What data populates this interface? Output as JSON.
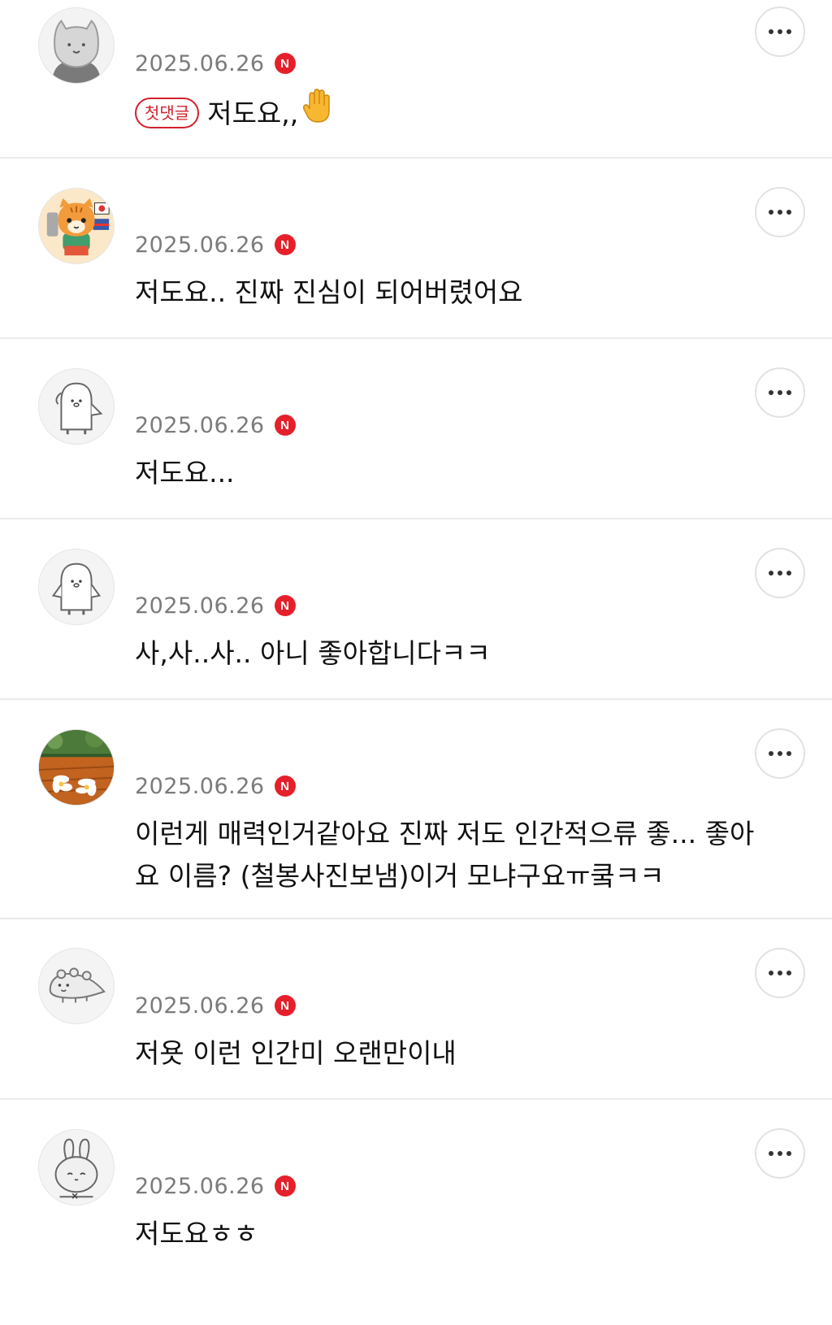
{
  "comments": [
    {
      "date": "2025.06.26",
      "badge": "N",
      "tag": "첫댓글",
      "text": "저도요,,",
      "avatar": "gray-cat-avatar"
    },
    {
      "date": "2025.06.26",
      "badge": "N",
      "tag": "",
      "text": "저도요.. 진짜 진심이 되어버렸어요",
      "avatar": "tiger-cat-with-flags-avatar"
    },
    {
      "date": "2025.06.26",
      "badge": "N",
      "tag": "",
      "text": "저도요...",
      "avatar": "penguin-avatar"
    },
    {
      "date": "2025.06.26",
      "badge": "N",
      "tag": "",
      "text": "사,사..사..  아니 좋아합니다ㅋㅋ",
      "avatar": "penguin-avatar"
    },
    {
      "date": "2025.06.26",
      "badge": "N",
      "tag": "",
      "text": "이런게 매력인거같아요 진짜   저도 인간적으류 좋... 좋아요 이름?  (철봉사진보냄)이거 모냐구요ㅠ쿸ㅋㅋ",
      "avatar": "flower-photo-avatar"
    },
    {
      "date": "2025.06.26",
      "badge": "N",
      "tag": "",
      "text": "저욧 이런 인간미 오랜만이내",
      "avatar": "lizard-avatar"
    },
    {
      "date": "2025.06.26",
      "badge": "N",
      "tag": "",
      "text": "저도요ㅎㅎ",
      "avatar": "rabbit-avatar"
    }
  ],
  "colors": {
    "badge": "#e5202a",
    "tag": "#d3212d",
    "date": "#7b7b7b",
    "divider": "#ebebeb"
  },
  "icons": {
    "more": "more-horizontal-icon",
    "new": "new-badge-icon",
    "hand": "raised-hand-emoji"
  }
}
